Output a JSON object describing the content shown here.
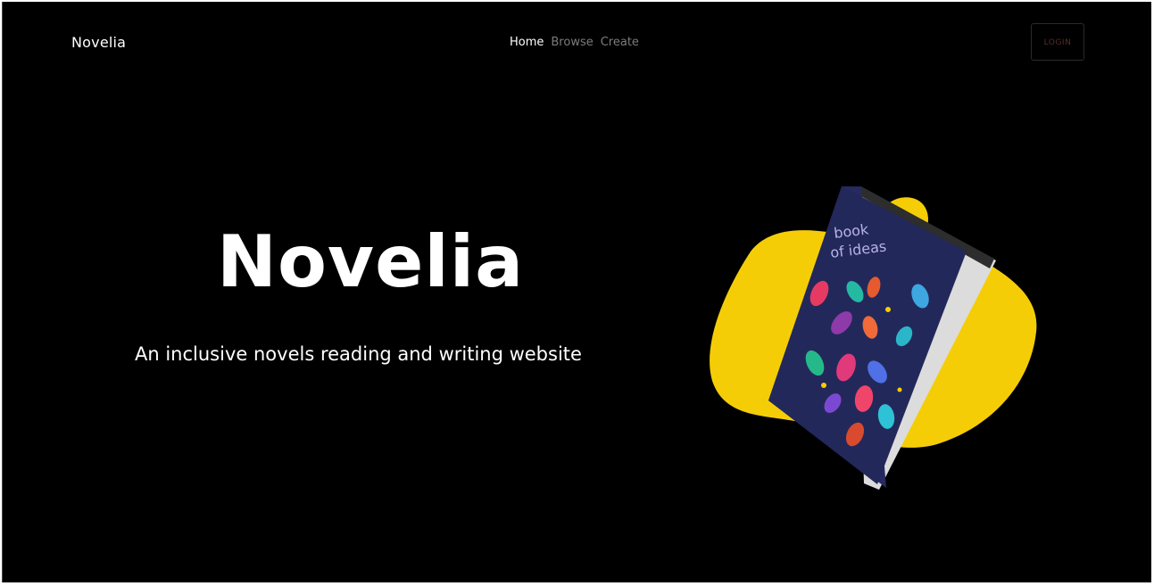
{
  "header": {
    "brand": "Novelia",
    "nav": [
      {
        "label": "Home",
        "active": true
      },
      {
        "label": "Browse",
        "active": false
      },
      {
        "label": "Create",
        "active": false
      }
    ],
    "login_label": "LOGIN"
  },
  "hero": {
    "title": "Novelia",
    "subtitle": "An inclusive novels reading and writing website"
  },
  "book": {
    "cover_title": "book of ideas",
    "cover_color": "#262a5e",
    "blob_color": "#f5cd07"
  },
  "colors": {
    "background": "#000000",
    "text": "#ffffff",
    "nav_inactive": "#7c7c7c"
  }
}
